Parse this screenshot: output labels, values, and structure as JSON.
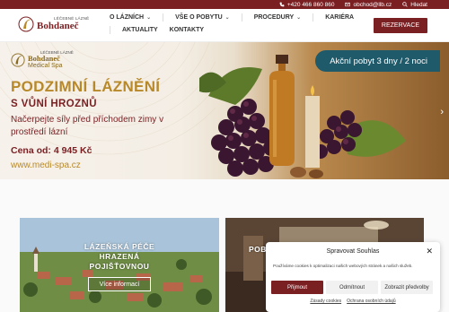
{
  "topbar": {
    "phone": "+420 466 860 860",
    "email": "obchod@llb.cz",
    "search": "Hledat",
    "colors": {
      "bg": "#7a1f22",
      "text": "#ffffff"
    }
  },
  "header": {
    "logo_small": "LÉČEBNÉ LÁZNĚ",
    "logo_big": "Bohdaneč",
    "nav": [
      {
        "label": "O LÁZNÍCH",
        "dropdown": true
      },
      {
        "label": "VŠE O POBYTU",
        "dropdown": true
      },
      {
        "label": "PROCEDURY",
        "dropdown": true
      },
      {
        "label": "KARIÉRA",
        "dropdown": false
      },
      {
        "label": "AKTUALITY",
        "dropdown": false
      },
      {
        "label": "KONTAKTY",
        "dropdown": false
      }
    ],
    "reserve_label": "REZERVACE",
    "accent": "#7a1f22"
  },
  "hero": {
    "logo_small": "LÉČEBNÉ LÁZNĚ",
    "logo_line1": "Bohdaneč",
    "logo_line2": "Medical Spa",
    "badge": "Akční pobyt 3 dny / 2 noci",
    "title": "PODZIMNÍ LÁZNĚNÍ",
    "subtitle": "S VŮNÍ HROZNŮ",
    "description": "Načerpejte síly před příchodem zimy v prostředí lázní",
    "price": "Cena od: 4 945 Kč",
    "website": "www.medi-spa.cz",
    "next_icon": "chevron-right-icon",
    "colors": {
      "gold": "#b8892a",
      "burgundy": "#7a1f22",
      "badge": "#1f5a6b"
    }
  },
  "cards": [
    {
      "title": "LÁZEŇSKÁ PÉČE HRAZENÁ POJIŠŤOVNOU",
      "button": "Více informací"
    },
    {
      "title": "POB"
    }
  ],
  "cookie": {
    "title": "Spravovat Souhlas",
    "text": "Používáme cookies k optimalizaci našich webových stránek a našich služeb.",
    "accept": "Přijmout",
    "deny": "Odmítnout",
    "preferences": "Zobrazit předvolby",
    "link_cookies": "Zásady cookies",
    "link_privacy": "Ochrana osobních údajů"
  }
}
